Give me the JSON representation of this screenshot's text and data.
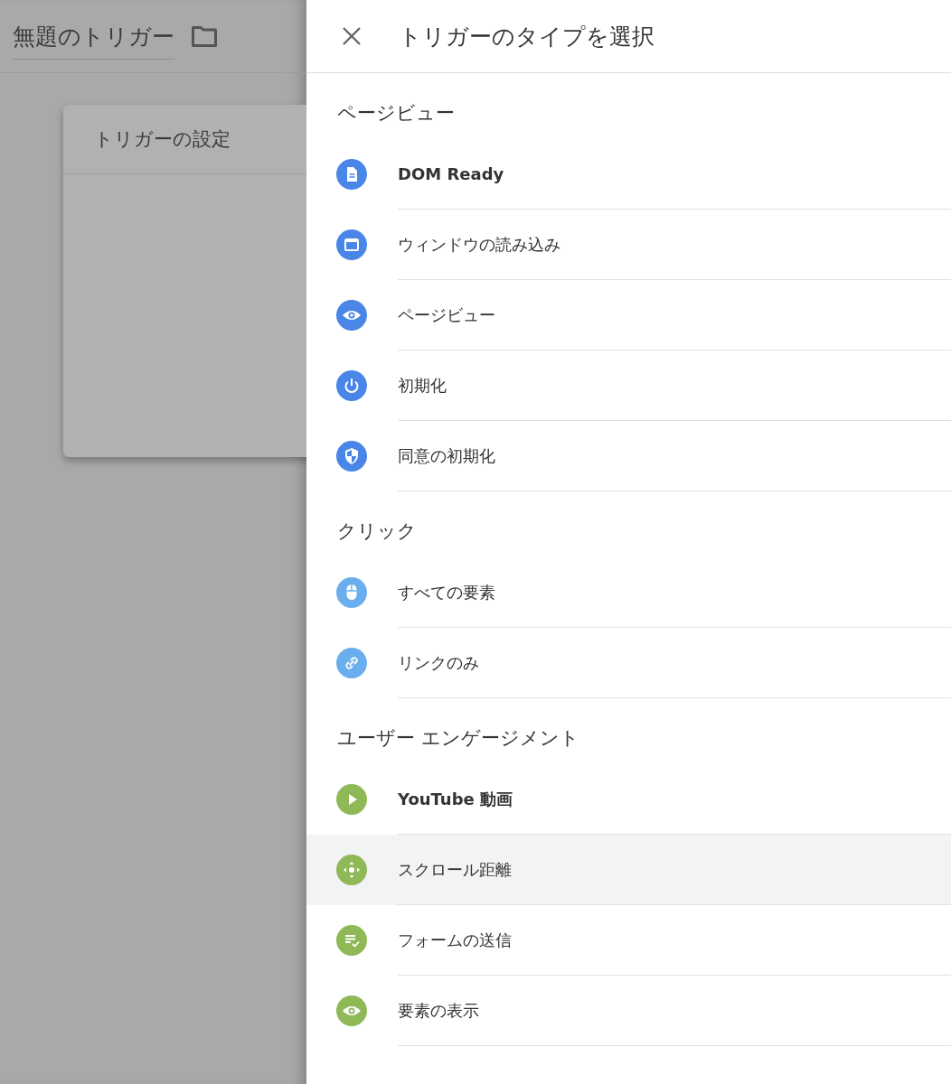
{
  "background": {
    "trigger_name": "無題のトリガー",
    "card": {
      "title": "トリガーの設定"
    }
  },
  "panel": {
    "title": "トリガーのタイプを選択",
    "sections": [
      {
        "heading": "ページビュー",
        "items": [
          {
            "label": "DOM Ready",
            "kind": "document",
            "color": "#4a86e8",
            "bold": true,
            "selected": false
          },
          {
            "label": "ウィンドウの読み込み",
            "kind": "window",
            "color": "#4a86e8",
            "bold": false,
            "selected": false
          },
          {
            "label": "ページビュー",
            "kind": "eye",
            "color": "#4a86e8",
            "bold": false,
            "selected": false
          },
          {
            "label": "初期化",
            "kind": "power",
            "color": "#4a86e8",
            "bold": false,
            "selected": false
          },
          {
            "label": "同意の初期化",
            "kind": "shield",
            "color": "#4a86e8",
            "bold": false,
            "selected": false
          }
        ]
      },
      {
        "heading": "クリック",
        "items": [
          {
            "label": "すべての要素",
            "kind": "mouse",
            "color": "#6aaeee",
            "bold": false,
            "selected": false
          },
          {
            "label": "リンクのみ",
            "kind": "link",
            "color": "#6aaeee",
            "bold": false,
            "selected": false
          }
        ]
      },
      {
        "heading": "ユーザー エンゲージメント",
        "items": [
          {
            "label": "YouTube 動画",
            "kind": "play",
            "color": "#8fb856",
            "bold": true,
            "selected": false
          },
          {
            "label": "スクロール距離",
            "kind": "move",
            "color": "#8fb856",
            "bold": false,
            "selected": true
          },
          {
            "label": "フォームの送信",
            "kind": "checklist",
            "color": "#8fb856",
            "bold": false,
            "selected": false
          },
          {
            "label": "要素の表示",
            "kind": "eye",
            "color": "#8fb856",
            "bold": false,
            "selected": false
          }
        ]
      }
    ]
  }
}
